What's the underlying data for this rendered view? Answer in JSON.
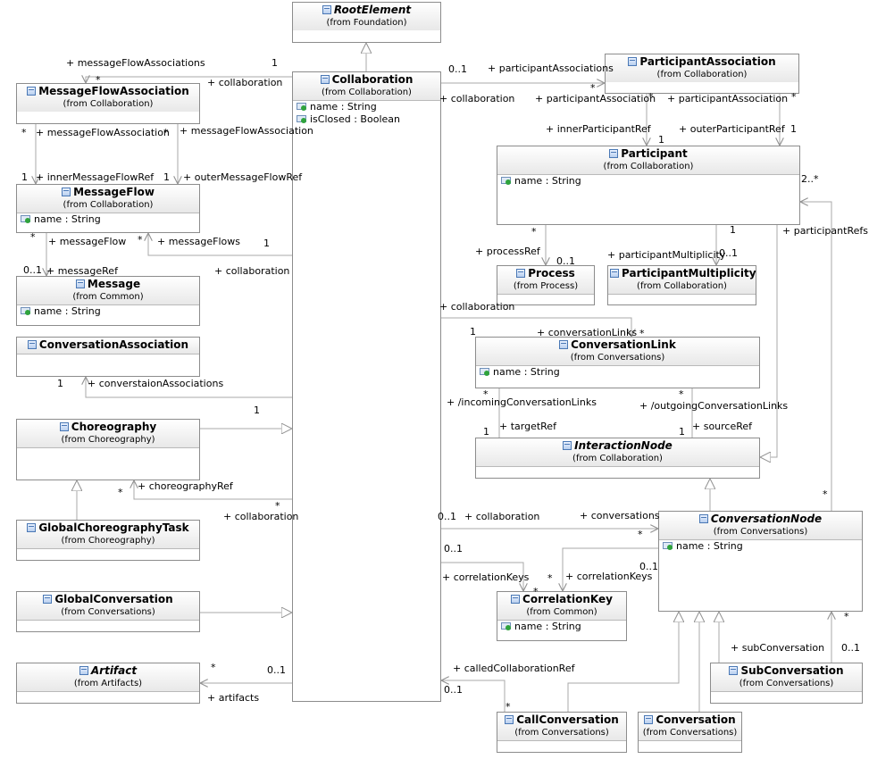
{
  "classes": {
    "root_element": {
      "name": "RootElement",
      "from": "(from Foundation)"
    },
    "collaboration": {
      "name": "Collaboration",
      "from": "(from Collaboration)",
      "attrs": [
        "name : String",
        "isClosed : Boolean"
      ]
    },
    "participant_association": {
      "name": "ParticipantAssociation",
      "from": "(from Collaboration)"
    },
    "message_flow_association": {
      "name": "MessageFlowAssociation",
      "from": "(from Collaboration)"
    },
    "message_flow": {
      "name": "MessageFlow",
      "from": "(from Collaboration)",
      "attrs": [
        "name : String"
      ]
    },
    "message": {
      "name": "Message",
      "from": "(from Common)",
      "attrs": [
        "name : String"
      ]
    },
    "conversation_association": {
      "name": "ConversationAssociation"
    },
    "choreography": {
      "name": "Choreography",
      "from": "(from Choreography)"
    },
    "global_choreography_task": {
      "name": "GlobalChoreographyTask",
      "from": "(from Choreography)"
    },
    "global_conversation": {
      "name": "GlobalConversation",
      "from": "(from Conversations)"
    },
    "artifact": {
      "name": "Artifact",
      "from": "(from Artifacts)"
    },
    "participant": {
      "name": "Participant",
      "from": "(from Collaboration)",
      "attrs": [
        "name : String"
      ]
    },
    "process": {
      "name": "Process",
      "from": "(from Process)"
    },
    "participant_multiplicity": {
      "name": "ParticipantMultiplicity",
      "from": "(from Collaboration)"
    },
    "conversation_link": {
      "name": "ConversationLink",
      "from": "(from Conversations)",
      "attrs": [
        "name : String"
      ]
    },
    "interaction_node": {
      "name": "InteractionNode",
      "from": "(from Collaboration)"
    },
    "conversation_node": {
      "name": "ConversationNode",
      "from": "(from Conversations)",
      "attrs": [
        "name : String"
      ]
    },
    "correlation_key": {
      "name": "CorrelationKey",
      "from": "(from Common)",
      "attrs": [
        "name : String"
      ]
    },
    "sub_conversation": {
      "name": "SubConversation",
      "from": "(from Conversations)"
    },
    "call_conversation": {
      "name": "CallConversation",
      "from": "(from Conversations)"
    },
    "conversation": {
      "name": "Conversation",
      "from": "(from Conversations)"
    }
  },
  "labels": {
    "mfa_role": "+ messageFlowAssociations",
    "mfa_mult_star": "*",
    "mfa_collab_mult": "1",
    "mfa_collab_role": "+ collaboration",
    "mfa_inner_star": "*",
    "mfa_inner_role": "+ messageFlowAssociation",
    "mfa_outer_star": "*",
    "mfa_outer_role": "+ messageFlowAssociation",
    "inner_mf_mult": "1",
    "inner_mf_role": "+ innerMessageFlowRef",
    "outer_mf_mult": "1",
    "outer_mf_role": "+ outerMessageFlowRef",
    "mf_msg_star": "*",
    "mf_msg_role": "+ messageFlow",
    "mf_flows_star": "*",
    "mf_flows_role": "+ messageFlows",
    "mf_collab_mult": "1",
    "mf_collab_role": "+ collaboration",
    "msg_ref_mult": "0..1",
    "msg_ref_role": "+ messageRef",
    "ca_mult1": "1",
    "ca_role": "+ converstaionAssociations",
    "ca_collab_mult": "1",
    "choreo_star": "*",
    "choreo_role": "+ choreographyRef",
    "choreo_collab_star": "*",
    "choreo_collab_role": "+ collaboration",
    "art_star": "*",
    "art_mult": "0..1",
    "art_role": "+ artifacts",
    "pa_mult": "0..1",
    "pa_role": "+ participantAssociations",
    "pa_star": "*",
    "pa_collab_role": "+ collaboration",
    "pa_inner_assoc_role": "+ participantAssociation",
    "pa_inner_star": "*",
    "pa_outer_assoc_role": "+ participantAssociation",
    "pa_outer_star": "*",
    "inner_pref_role": "+ innerParticipantRef",
    "inner_pref_mult": "1",
    "outer_pref_role": "+ outerParticipantRef",
    "outer_pref_mult": "1",
    "prefs_mult": "2..*",
    "prefs_role": "+ participantRefs",
    "proc_star": "*",
    "proc_role": "+ processRef",
    "proc_mult": "0..1",
    "pm_mult1": "1",
    "pm_role": "+ participantMultiplicity",
    "pm_mult": "0..1",
    "cl_collab_role": "+ collaboration",
    "cl_mult1": "1",
    "cl_role": "+ conversationLinks",
    "cl_star": "*",
    "in_star": "*",
    "in_role": "+ /incomingConversationLinks",
    "out_star": "*",
    "out_role": "+ /outgoingConversationLinks",
    "target_mult": "1",
    "target_role": "+ targetRef",
    "source_mult": "1",
    "source_role": "+ sourceRef",
    "cn_collab_mult": "0..1",
    "cn_collab_role": "+ collaboration",
    "cn_role": "+ conversations",
    "cn_star": "*",
    "ck_mult": "0..1",
    "ck_role": "+ correlationKeys",
    "ck_star": "*",
    "cn_ck_role": "+ correlationKeys",
    "cn_ck_star": "*",
    "cn_ck_mult": "0..1",
    "sub_star": "*",
    "sub_role": "+ subConversation",
    "sub_mult": "0..1",
    "cn_pref_star": "*",
    "call_role": "+ calledCollaborationRef",
    "call_mult": "0..1",
    "call_star": "*"
  },
  "colors": {
    "line": "#a0a0a0",
    "box_border": "#8c8c8c",
    "attr_icon": "#2fa33c",
    "class_icon": "#4a78b5"
  }
}
